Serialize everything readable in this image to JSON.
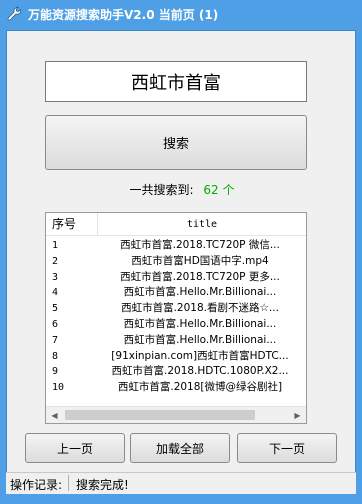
{
  "window": {
    "title": "万能资源搜索助手V2.0  当前页 (1)"
  },
  "search": {
    "query": "西虹市首富",
    "button_label": "搜索"
  },
  "results_summary": {
    "label": "一共搜索到:",
    "count": "62 个"
  },
  "result_list": {
    "columns": [
      "序号",
      "title"
    ],
    "rows": [
      {
        "index": "1",
        "title": "西虹市首富.2018.TC720P  微信..."
      },
      {
        "index": "2",
        "title": "西虹市首富HD国语中字.mp4"
      },
      {
        "index": "3",
        "title": "西虹市首富.2018.TC720P  更多..."
      },
      {
        "index": "4",
        "title": "西虹市首富.Hello.Mr.Billionai..."
      },
      {
        "index": "5",
        "title": "西虹市首富.2018.看剧不迷路☆..."
      },
      {
        "index": "6",
        "title": "西虹市首富.Hello.Mr.Billionai..."
      },
      {
        "index": "7",
        "title": "西虹市首富.Hello.Mr.Billionai..."
      },
      {
        "index": "8",
        "title": "[91xinpian.com]西虹市首富HDTC..."
      },
      {
        "index": "9",
        "title": "西虹市首富.2018.HDTC.1080P.X2..."
      },
      {
        "index": "10",
        "title": "西虹市首富.2018[微博@绿谷剧社]"
      }
    ]
  },
  "navigation": {
    "prev_label": "上一页",
    "load_all_label": "加载全部",
    "next_label": "下一页"
  },
  "status": {
    "label": "操作记录:",
    "text": "搜索完成!"
  },
  "colors": {
    "titlebar": "#4f9fe6",
    "count_value": "#00b000"
  },
  "icons": {
    "app_icon": "wrench-icon"
  }
}
